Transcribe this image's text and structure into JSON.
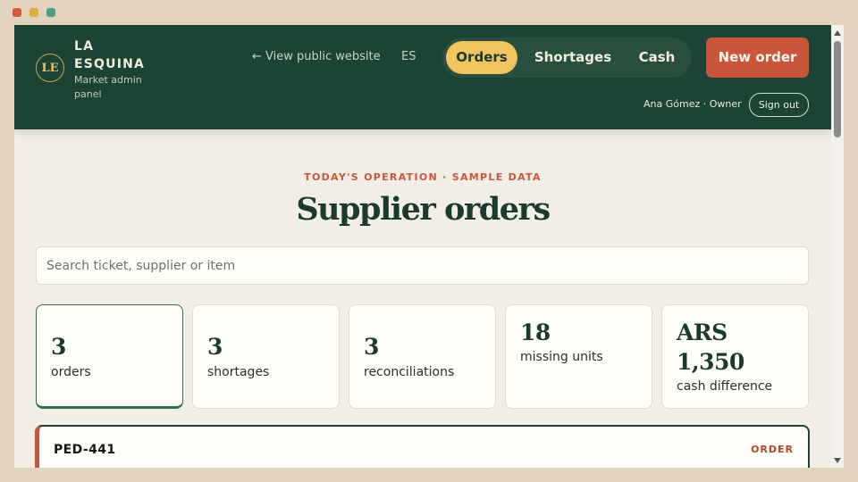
{
  "brand": {
    "logo_initials": "LE",
    "name": "LA ESQUINA",
    "subtitle": "Market admin panel"
  },
  "header": {
    "view_public_link": "← View public website",
    "language": "ES",
    "tabs": [
      {
        "label": "Orders",
        "active": true
      },
      {
        "label": "Shortages",
        "active": false
      },
      {
        "label": "Cash",
        "active": false
      }
    ],
    "new_order_label": "New order",
    "user": "Ana Gómez · Owner",
    "sign_out_label": "Sign out"
  },
  "main": {
    "kicker": "TODAY'S OPERATION · SAMPLE DATA",
    "title": "Supplier orders",
    "search_placeholder": "Search ticket, supplier or item",
    "search_value": "",
    "stats": [
      {
        "value": "3",
        "label": "orders",
        "selected": true
      },
      {
        "value": "3",
        "label": "shortages",
        "selected": false
      },
      {
        "value": "3",
        "label": "reconciliations",
        "selected": false
      },
      {
        "value": "18",
        "label": "missing units",
        "selected": false
      },
      {
        "value": "ARS 1,350",
        "label": "cash difference",
        "selected": false
      }
    ],
    "orders": [
      {
        "id": "PED-441",
        "tag": "ORDER"
      }
    ]
  },
  "colors": {
    "header_bg": "#1b4435",
    "accent": "#c8563a",
    "active_tab": "#f1c45e",
    "page_bg": "#f2eee6"
  }
}
